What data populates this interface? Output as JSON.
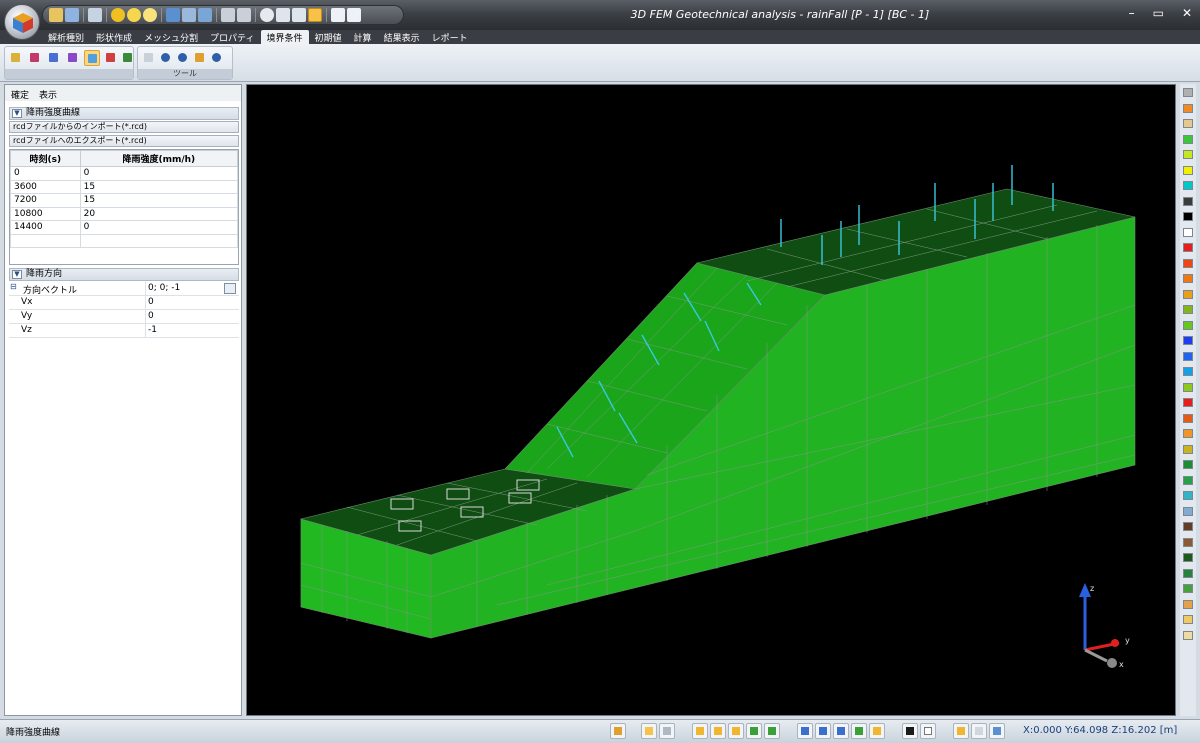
{
  "window": {
    "title": "3D FEM Geotechnical analysis - rainFall [P - 1] [BC - 1]",
    "controls": [
      "–",
      "▭",
      "✕"
    ]
  },
  "tabs": [
    "解析種別",
    "形状作成",
    "メッシュ分割",
    "プロパティ",
    "境界条件",
    "初期値",
    "計算",
    "結果表示",
    "レポート"
  ],
  "active_tab": "境界条件",
  "ribbon": {
    "tools_group_label": "ツール"
  },
  "left_panel": {
    "menu": [
      "確定",
      "表示"
    ],
    "rain_curve_section": "降雨強度曲線",
    "import_button": "rcdファイルからのインポート(*.rcd)",
    "export_button": "rcdファイルへのエクスポート(*.rcd)",
    "table": {
      "headers": [
        "時刻(s)",
        "降雨強度(mm/h)"
      ],
      "rows": [
        [
          "0",
          "0"
        ],
        [
          "3600",
          "15"
        ],
        [
          "7200",
          "15"
        ],
        [
          "10800",
          "20"
        ],
        [
          "14400",
          "0"
        ]
      ]
    },
    "direction_section": "降雨方向",
    "direction": {
      "label": "方向ベクトル",
      "value": "0; 0; -1",
      "vx_label": "Vx",
      "vx": "0",
      "vy_label": "Vy",
      "vy": "0",
      "vz_label": "Vz",
      "vz": "-1"
    }
  },
  "viewport": {
    "axis_labels": {
      "x": "x",
      "y": "y",
      "z": "z"
    },
    "mesh_color": "#19b319",
    "top_face_color": "#0e4f12",
    "rain_vector_color": "#38c8e0"
  },
  "palette": {
    "colors": [
      "#b0b0b0",
      "#f08a24",
      "#e6c88c",
      "#36c836",
      "#c8e61e",
      "#f0f000",
      "#00c8c8",
      "#3c3c3c",
      "#000000",
      "#ffffff",
      "#e61e1e",
      "#f04614",
      "#f07814",
      "#e6a01e",
      "#82b41e",
      "#64c81e",
      "#1e3cf0",
      "#1e64f0",
      "#14a0e6",
      "#8cc81e",
      "#e61e1e",
      "#e65a14",
      "#f09628",
      "#c8b41e",
      "#1e8c32",
      "#28a046",
      "#32b4c8",
      "#82aad2",
      "#643c28",
      "#8c5a32",
      "#1e5a1e",
      "#28823c",
      "#46a03c",
      "#e6a04a",
      "#f0c864",
      "#f0dca0"
    ]
  },
  "status_bar": {
    "text": "降雨強度曲線",
    "coordinates": "X:0.000 Y:64.098 Z:16.202 [m]"
  }
}
